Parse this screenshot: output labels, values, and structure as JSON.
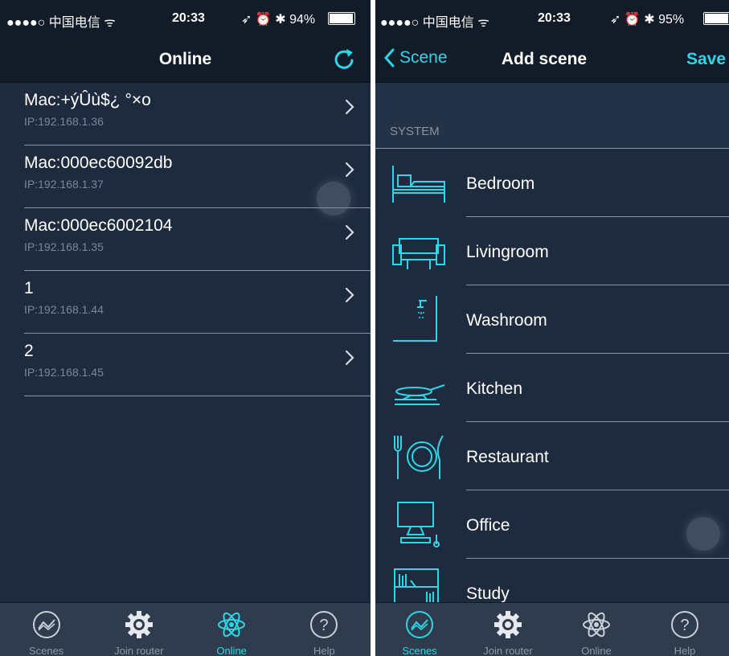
{
  "colors": {
    "accent": "#2fd6e6",
    "background": "#1e2b3f",
    "bar": "#121b28",
    "tabbar": "#2f3c4e",
    "muted": "#7b8797"
  },
  "left": {
    "status": {
      "signal": "●●●●○ 中国电信 ᯤ",
      "time": "20:33",
      "right": "➶ ⏰ ✱ 94%"
    },
    "nav": {
      "title": "Online",
      "refresh_icon": "refresh-icon"
    },
    "devices": [
      {
        "name": "Mac:+ýÛù$¿ °×o",
        "ip": "IP:192.168.1.36"
      },
      {
        "name": "Mac:000ec60092db",
        "ip": "IP:192.168.1.37"
      },
      {
        "name": "Mac:000ec6002104",
        "ip": "IP:192.168.1.35"
      },
      {
        "name": "1",
        "ip": "IP:192.168.1.44"
      },
      {
        "name": "2",
        "ip": "IP:192.168.1.45"
      }
    ],
    "tabs": [
      {
        "label": "Scenes",
        "icon": "scenes-icon",
        "active": false
      },
      {
        "label": "Join router",
        "icon": "gear-icon",
        "active": false
      },
      {
        "label": "Online",
        "icon": "atom-icon",
        "active": true
      },
      {
        "label": "Help",
        "icon": "help-icon",
        "active": false
      }
    ]
  },
  "right": {
    "status": {
      "signal": "●●●●○ 中国电信 ᯤ",
      "time": "20:33",
      "right": "➶ ⏰ ✱ 95%"
    },
    "nav": {
      "back_label": "Scene",
      "title": "Add scene",
      "save_label": "Save"
    },
    "section_label": "SYSTEM",
    "scenes": [
      {
        "name": "Bedroom",
        "icon": "bed-icon"
      },
      {
        "name": "Livingroom",
        "icon": "sofa-icon"
      },
      {
        "name": "Washroom",
        "icon": "shower-icon"
      },
      {
        "name": "Kitchen",
        "icon": "pan-icon"
      },
      {
        "name": "Restaurant",
        "icon": "plate-icon"
      },
      {
        "name": "Office",
        "icon": "computer-icon"
      },
      {
        "name": "Study",
        "icon": "bookshelf-icon"
      }
    ],
    "tabs": [
      {
        "label": "Scenes",
        "icon": "scenes-icon",
        "active": true
      },
      {
        "label": "Join router",
        "icon": "gear-icon",
        "active": false
      },
      {
        "label": "Online",
        "icon": "atom-icon",
        "active": false
      },
      {
        "label": "Help",
        "icon": "help-icon",
        "active": false
      }
    ]
  }
}
